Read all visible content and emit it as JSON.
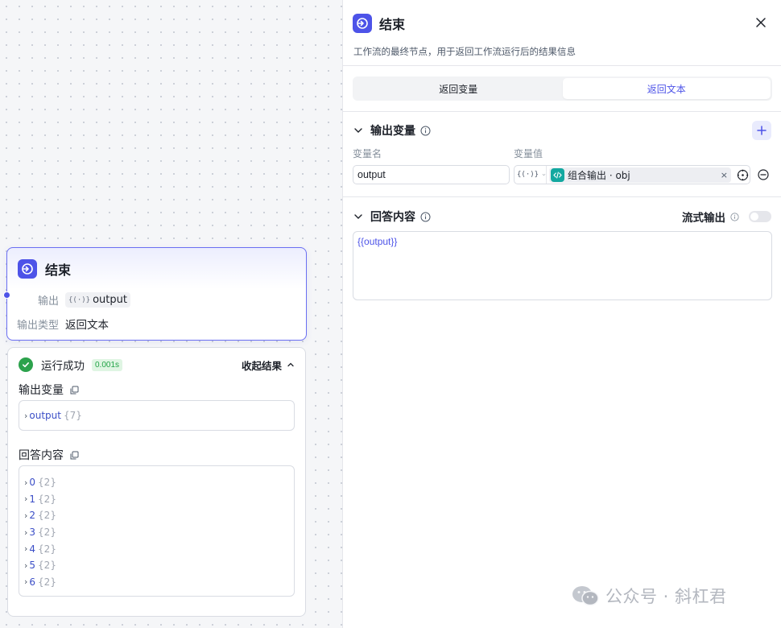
{
  "node": {
    "title": "结束",
    "output_label": "输出",
    "output_var": "output",
    "output_var_brace": "{(·)}",
    "output_type_label": "输出类型",
    "output_type_value": "返回文本"
  },
  "result": {
    "status": "运行成功",
    "time": "0.001s",
    "collapse_label": "收起结果",
    "output_section_title": "输出变量",
    "output_items": [
      {
        "key": "output",
        "count": "{7}"
      }
    ],
    "answer_section_title": "回答内容",
    "answer_items": [
      {
        "key": "0",
        "count": "{2}"
      },
      {
        "key": "1",
        "count": "{2}"
      },
      {
        "key": "2",
        "count": "{2}"
      },
      {
        "key": "3",
        "count": "{2}"
      },
      {
        "key": "4",
        "count": "{2}"
      },
      {
        "key": "5",
        "count": "{2}"
      },
      {
        "key": "6",
        "count": "{2}"
      }
    ]
  },
  "panel": {
    "title": "结束",
    "description": "工作流的最终节点，用于返回工作流运行后的结果信息",
    "tabs": [
      {
        "label": "返回变量",
        "active": false
      },
      {
        "label": "返回文本",
        "active": true
      }
    ],
    "output_section": {
      "title": "输出变量",
      "col_name": "变量名",
      "col_value": "变量值",
      "name_value": "output",
      "type_brace": "{(·)}",
      "ref_label": "组合输出 · obj",
      "ref_clear": "×"
    },
    "answer_section": {
      "title": "回答内容",
      "stream_label": "流式输出",
      "stream_enabled": false,
      "content": "{{output}}"
    }
  },
  "watermark": "公众号 · 斜杠君",
  "colors": {
    "accent": "#4d53e8",
    "success": "#2ca24c",
    "ref_icon": "#13a8a0"
  }
}
